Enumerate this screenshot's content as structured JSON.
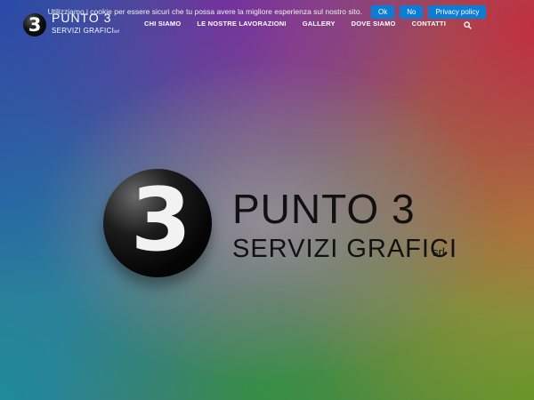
{
  "cookie": {
    "message": "Utilizziamo i cookie per essere sicuri che tu possa avere la migliore esperienza sul nostro sito.",
    "ok_label": "Ok",
    "no_label": "No",
    "privacy_label": "Privacy policy",
    "button_color": "#0c7cd5"
  },
  "brand": {
    "logo_numeral": "3",
    "name": "PUNTO 3",
    "tagline": "SERVIZI GRAFICI",
    "suffix": "srl"
  },
  "nav": {
    "items": [
      {
        "label": "CHI SIAMO"
      },
      {
        "label": "LE NOSTRE LAVORAZIONI"
      },
      {
        "label": "GALLERY"
      },
      {
        "label": "DOVE SIAMO"
      },
      {
        "label": "CONTATTI"
      }
    ],
    "search_icon": "search-icon"
  }
}
